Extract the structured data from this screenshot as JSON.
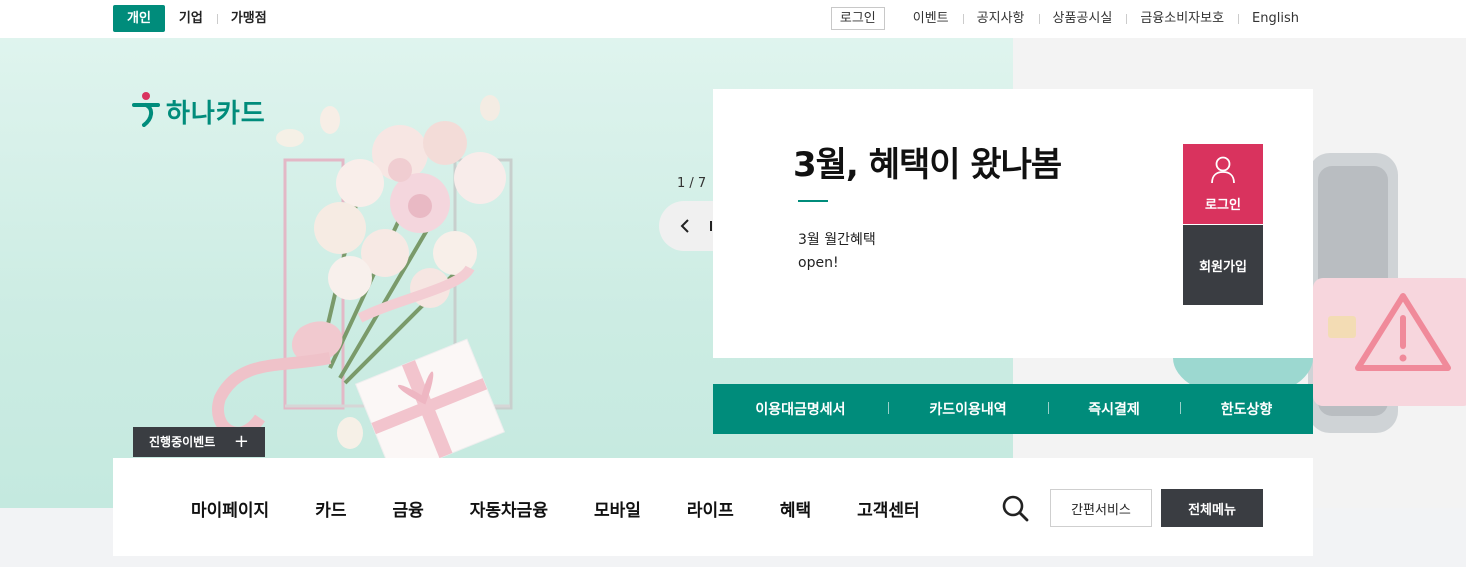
{
  "top_tabs": [
    "개인",
    "기업",
    "가맹점"
  ],
  "util_links": {
    "login": "로그인",
    "items": [
      "이벤트",
      "공지사항",
      "상품공시실",
      "금융소비자보호",
      "English"
    ]
  },
  "logo_text": "하나카드",
  "event_tag": {
    "label": "진행중이벤트",
    "plus": "+"
  },
  "slider": {
    "counter": "1 / 7"
  },
  "banner": {
    "title": "3월, 혜택이 왔나봄",
    "sub_line1": "3월 월간혜택",
    "sub_line2": "open!"
  },
  "member": {
    "login": "로그인",
    "join": "회원가입"
  },
  "quick_links": [
    "이용대금명세서",
    "카드이용내역",
    "즉시결제",
    "한도상향"
  ],
  "gnb": [
    "마이페이지",
    "카드",
    "금융",
    "자동차금융",
    "모바일",
    "라이프",
    "혜택",
    "고객센터"
  ],
  "buttons": {
    "easy": "간편서비스",
    "all_menu": "전체메뉴"
  },
  "colors": {
    "brand": "#008c7b",
    "login_tile": "#d9335e",
    "dark": "#3a3d42"
  },
  "icons": [
    "hana-logo-icon",
    "user-icon",
    "search-icon",
    "chevron-left-icon",
    "pause-icon",
    "chevron-right-icon",
    "plus-icon"
  ]
}
